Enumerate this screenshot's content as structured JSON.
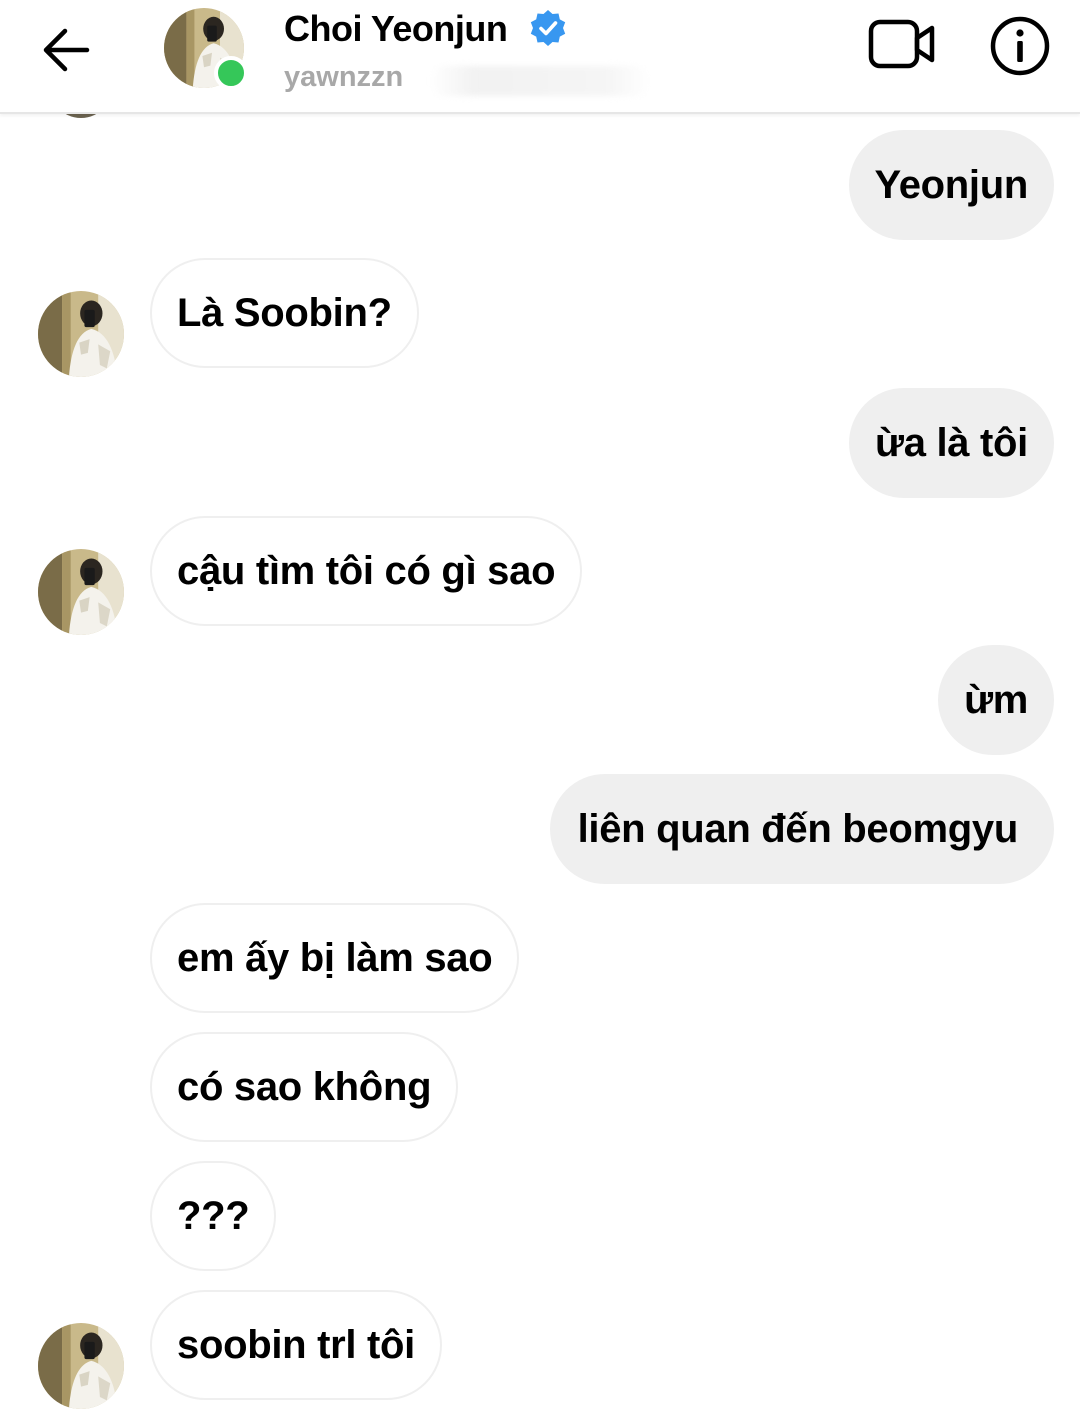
{
  "header": {
    "contact_name": "Choi Yeonjun",
    "username": "yawnzzn",
    "verified_color": "#3897f0",
    "online_color": "#35c759"
  },
  "icons": {
    "back": "arrow-left-icon",
    "verified": "verified-badge-icon",
    "video": "video-camera-icon",
    "info": "info-icon"
  },
  "messages": [
    {
      "side": "out",
      "text": "Yeonjun"
    },
    {
      "side": "in",
      "text": "Là Soobin?",
      "avatar": true
    },
    {
      "side": "out",
      "text": "ừa là tôi"
    },
    {
      "side": "in",
      "text": "cậu tìm tôi có gì sao",
      "avatar": true
    },
    {
      "side": "out",
      "text": "ừm"
    },
    {
      "side": "out",
      "text": "liên quan đến beomgyu"
    },
    {
      "side": "in",
      "text": "em ấy bị làm sao",
      "avatar": false
    },
    {
      "side": "in",
      "text": "có sao không",
      "avatar": false
    },
    {
      "side": "in",
      "text": "???",
      "avatar": false
    },
    {
      "side": "in",
      "text": "soobin trl tôi",
      "avatar": true
    }
  ]
}
